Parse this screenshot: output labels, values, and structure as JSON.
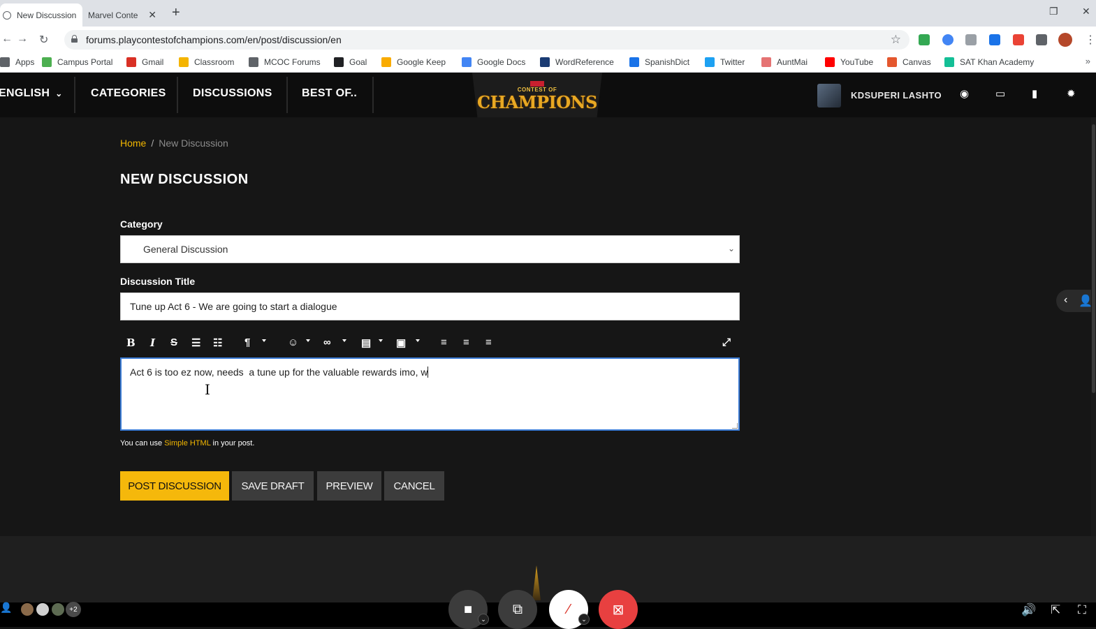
{
  "browser": {
    "tabs": [
      {
        "title": "New Discussion",
        "active": true
      },
      {
        "title": "Marvel Conte",
        "active": false
      }
    ],
    "new_tab": "+",
    "close_glyph": "✕",
    "url": "forums.playcontestofchampions.com/en/post/discussion/en",
    "bookmarks": [
      {
        "label": "Apps",
        "color": "#5f6368"
      },
      {
        "label": "Campus Portal",
        "color": "#4caf50"
      },
      {
        "label": "Gmail",
        "color": "#d93025"
      },
      {
        "label": "Classroom",
        "color": "#f4b400"
      },
      {
        "label": "MCOC Forums",
        "color": "#5f6368"
      },
      {
        "label": "Goal",
        "color": "#202124"
      },
      {
        "label": "Google Keep",
        "color": "#f9ab00"
      },
      {
        "label": "Google Docs",
        "color": "#4285f4"
      },
      {
        "label": "WordReference",
        "color": "#1a3b73"
      },
      {
        "label": "SpanishDict",
        "color": "#1a73e8"
      },
      {
        "label": "Twitter",
        "color": "#1da1f2"
      },
      {
        "label": "AuntMai",
        "color": "#e57373"
      },
      {
        "label": "YouTube",
        "color": "#ff0000"
      },
      {
        "label": "Canvas",
        "color": "#e4572e"
      },
      {
        "label": "SAT Khan Academy",
        "color": "#14bf96"
      }
    ],
    "bookmarks_more": "»"
  },
  "header": {
    "nav": [
      "ENGLISH",
      "CATEGORIES",
      "DISCUSSIONS",
      "BEST OF.."
    ],
    "logo_brand": "MARVEL",
    "logo_sub": "CONTEST OF",
    "logo_main": "CHAMPIONS",
    "username": "KDSUPERI LASHTO"
  },
  "breadcrumb": {
    "home": "Home",
    "separator": "/",
    "current": "New Discussion"
  },
  "page_title": "NEW DISCUSSION",
  "form": {
    "category_label": "Category",
    "category_value": "General Discussion",
    "title_label": "Discussion Title",
    "title_value": "Tune up Act 6 - We are going to start a dialogue",
    "body_value": "Act 6 is too ez now, needs  a tune up for the valuable rewards imo, w",
    "hint_prefix": "You can use",
    "hint_link": "Simple HTML",
    "hint_suffix": "in your post."
  },
  "buttons": {
    "post": "POST DISCUSSION",
    "save": "SAVE DRAFT",
    "preview": "PREVIEW",
    "cancel": "CANCEL"
  },
  "meeting": {
    "participant_overflow": "+2"
  },
  "colors": {
    "accent": "#f5b80b",
    "header_bg": "#0d0d0d",
    "page_bg": "#161616",
    "end_call": "#e84040"
  }
}
